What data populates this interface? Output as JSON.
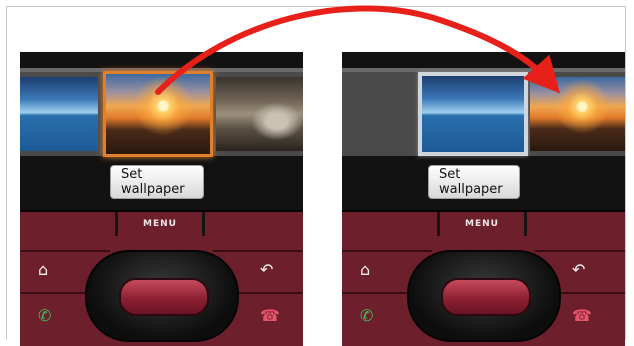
{
  "phones": [
    {
      "id": "left",
      "set_wallpaper_label": "Set wallpaper",
      "menu_label": "MENU",
      "thumbnails": [
        "lake",
        "sunset",
        "shore"
      ],
      "selected": "sunset"
    },
    {
      "id": "right",
      "set_wallpaper_label": "Set wallpaper",
      "menu_label": "MENU",
      "thumbnails": [
        "lake",
        "sunset"
      ],
      "selected": "lake"
    }
  ],
  "icons": {
    "home": "⌂",
    "back": "↶",
    "call": "✆",
    "end_call": "☎"
  },
  "colors": {
    "arrow": "#e8201a",
    "keypad": "#6e1f2c",
    "selection_orange": "#e0802a"
  }
}
